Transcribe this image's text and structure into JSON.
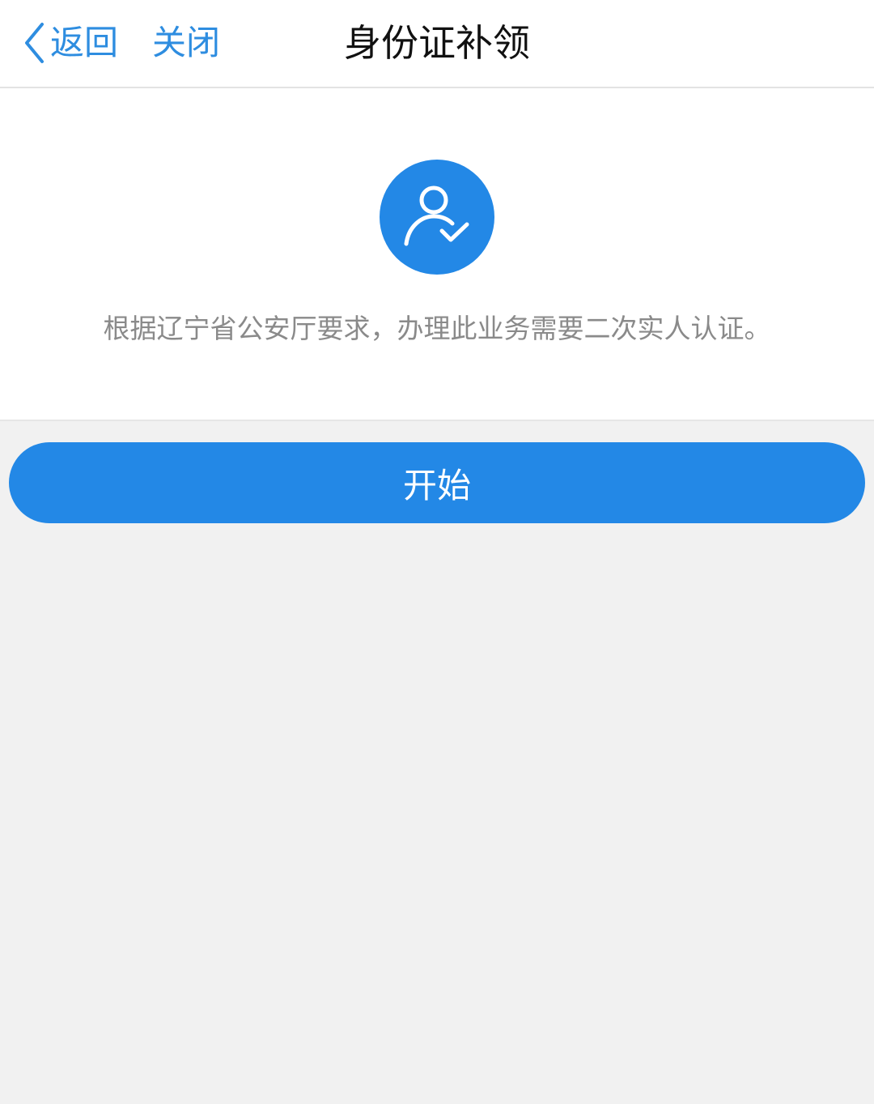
{
  "header": {
    "back_label": "返回",
    "close_label": "关闭",
    "title": "身份证补领"
  },
  "main": {
    "icon": "user-check-icon",
    "notice": "根据辽宁省公安厅要求，办理此业务需要二次实人认证。"
  },
  "actions": {
    "start_label": "开始"
  },
  "colors": {
    "accent": "#2388e6",
    "nav_link": "#2e8de0",
    "background": "#f1f1f1"
  }
}
